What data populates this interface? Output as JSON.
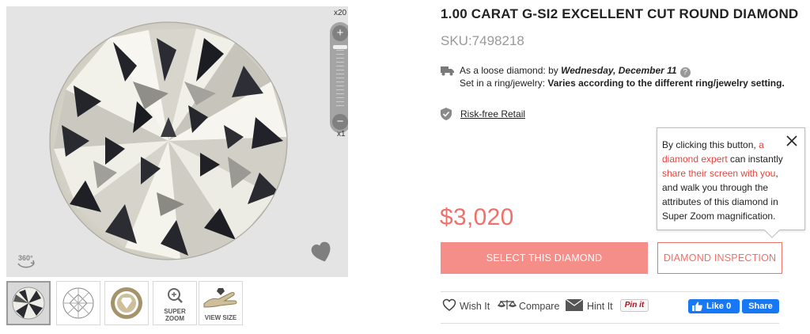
{
  "product": {
    "title": "1.00 CARAT G-SI2 EXCELLENT CUT ROUND DIAMOND",
    "sku": "SKU:7498218",
    "price": "$3,020"
  },
  "shipping": {
    "loose_prefix": "As a loose diamond: by ",
    "loose_date": "Wednesday, December 11",
    "help_glyph": "?",
    "ring_prefix": "Set in a ring/jewelry: ",
    "ring_value": "Varies according to the different ring/jewelry setting."
  },
  "risk_free": {
    "label": "Risk-free Retail"
  },
  "viewer": {
    "zoom_max": "x20",
    "zoom_min": "x1",
    "zoom_plus": "+",
    "zoom_minus": "−",
    "badge_360": "360°"
  },
  "thumbnails": [
    {
      "label": "",
      "icon": "diamond-photo"
    },
    {
      "label": "",
      "icon": "diamond-diagram"
    },
    {
      "label": "",
      "icon": "certificate-seal"
    },
    {
      "label_line1": "SUPER",
      "label_line2": "ZOOM",
      "icon": "magnifier"
    },
    {
      "label": "VIEW SIZE",
      "icon": "hand"
    }
  ],
  "buttons": {
    "select": "SELECT THIS DIAMOND",
    "inspect": "DIAMOND INSPECTION"
  },
  "tooltip": {
    "part1": "By clicking this button, ",
    "part2": "a diamond expert",
    "part3": " can instantly ",
    "part4": "share their screen with you",
    "part5": ", and walk you through the attributes of this diamond in Super Zoom magnification."
  },
  "actions": {
    "wish": "Wish It",
    "compare": "Compare",
    "hint": "Hint It",
    "pinit": "Pin it",
    "like": "Like 0",
    "share": "Share"
  },
  "colors": {
    "accent": "#f0706a",
    "select_button": "#f58e88",
    "tooltip_highlight": "#e8433b",
    "facebook": "#1877f2",
    "viewer_bg": "#e4e4e4"
  }
}
